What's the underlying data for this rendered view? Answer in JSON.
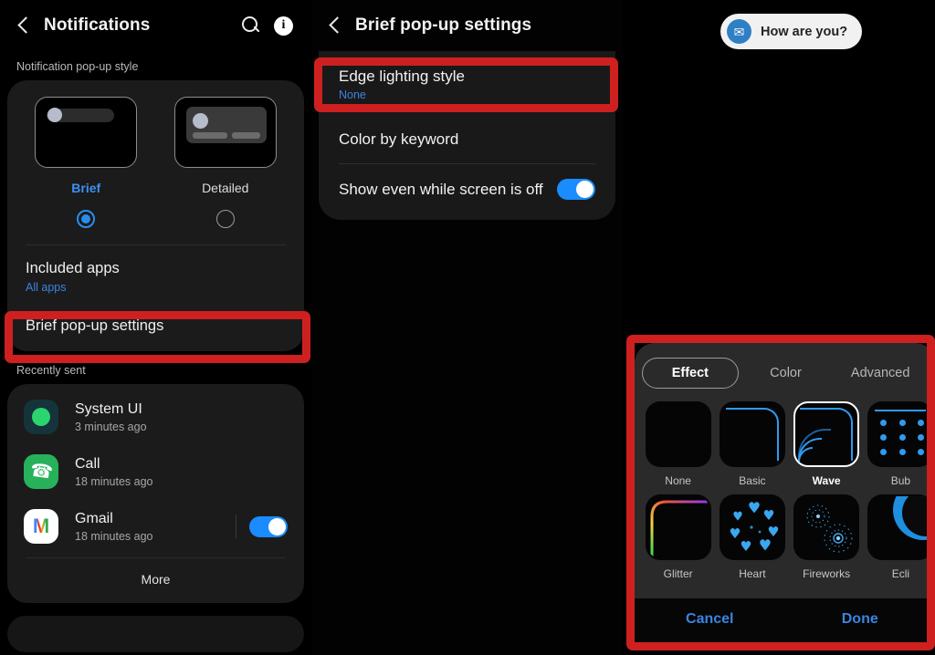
{
  "left_panel": {
    "appbar": {
      "title": "Notifications",
      "back_icon": "back-chevron-icon",
      "search_icon": "search-icon",
      "info_icon": "info-icon"
    },
    "popup_style": {
      "section_label": "Notification pop-up style",
      "options": [
        {
          "name": "Brief",
          "selected": true
        },
        {
          "name": "Detailed",
          "selected": false
        }
      ]
    },
    "included_apps": {
      "title": "Included apps",
      "value": "All apps"
    },
    "brief_popup_settings": {
      "title": "Brief pop-up settings",
      "highlighted": true
    },
    "recently_sent": {
      "section_label": "Recently sent",
      "items": [
        {
          "name": "System UI",
          "time": "3 minutes ago",
          "icon": "system-ui-icon",
          "has_toggle": false
        },
        {
          "name": "Call",
          "time": "18 minutes ago",
          "icon": "call-icon",
          "has_toggle": false
        },
        {
          "name": "Gmail",
          "time": "18 minutes ago",
          "icon": "gmail-icon",
          "has_toggle": true,
          "toggle_on": true
        }
      ],
      "more_label": "More"
    }
  },
  "mid_panel": {
    "appbar": {
      "title": "Brief pop-up settings",
      "back_icon": "back-chevron-icon"
    },
    "items": [
      {
        "title": "Edge lighting style",
        "value": "None",
        "highlighted": true
      },
      {
        "title": "Color by keyword",
        "value": ""
      },
      {
        "title": "Show even while screen is off",
        "toggle_on": true
      }
    ]
  },
  "right_panel": {
    "notification_preview": {
      "text": "How are you?",
      "icon": "mail-icon"
    },
    "effects_sheet": {
      "tabs": [
        {
          "label": "Effect",
          "active": true
        },
        {
          "label": "Color",
          "active": false
        },
        {
          "label": "Advanced",
          "active": false
        }
      ],
      "effects": [
        {
          "label": "None",
          "art": "none",
          "selected": false
        },
        {
          "label": "Basic",
          "art": "basic",
          "selected": false
        },
        {
          "label": "Wave",
          "art": "wave",
          "selected": true
        },
        {
          "label": "Bub",
          "art": "bubble",
          "selected": false
        },
        {
          "label": "Glitter",
          "art": "glitter",
          "selected": false
        },
        {
          "label": "Heart",
          "art": "heart",
          "selected": false
        },
        {
          "label": "Fireworks",
          "art": "fireworks",
          "selected": false
        },
        {
          "label": "Ecli",
          "art": "eclipse",
          "selected": false
        }
      ],
      "cancel_label": "Cancel",
      "done_label": "Done"
    }
  },
  "colors": {
    "accent_blue": "#3b84e2",
    "toggle_blue": "#1a8cff",
    "highlight_red": "#cf2020",
    "edge_blue": "#2f9bf0"
  }
}
